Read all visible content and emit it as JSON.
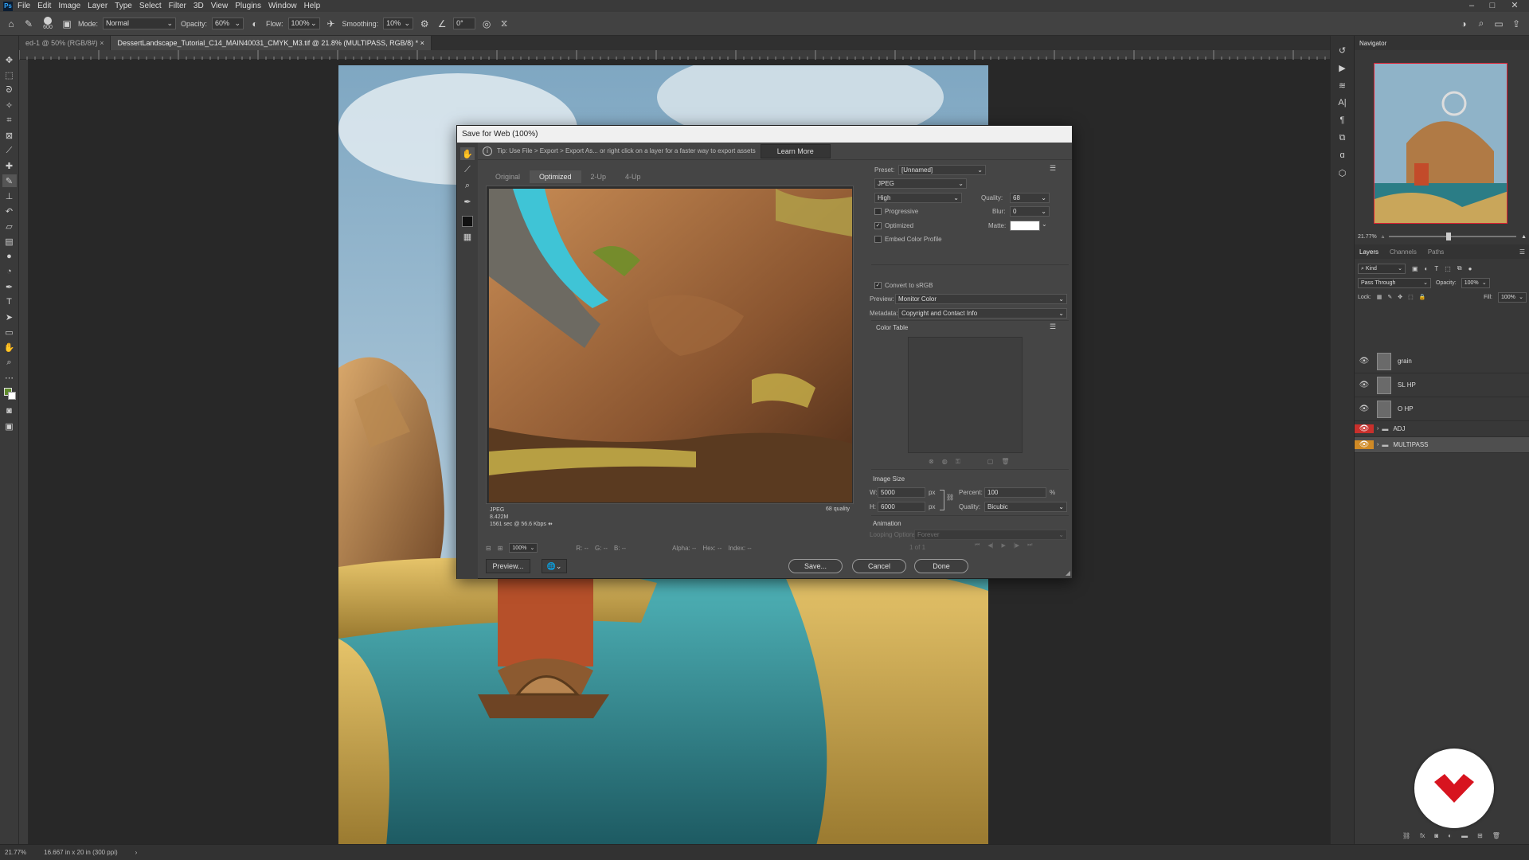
{
  "app": {
    "menu": [
      "File",
      "Edit",
      "Image",
      "Layer",
      "Type",
      "Select",
      "Filter",
      "3D",
      "View",
      "Plugins",
      "Window",
      "Help"
    ],
    "window_controls": [
      "–",
      "□",
      "✕"
    ]
  },
  "options_bar": {
    "brush_size": "600",
    "mode_label": "Mode:",
    "mode_value": "Normal",
    "opacity_label": "Opacity:",
    "opacity_value": "60%",
    "flow_label": "Flow:",
    "flow_value": "100%",
    "smoothing_label": "Smoothing:",
    "smoothing_value": "10%",
    "angle_value": "0°"
  },
  "tabs": [
    {
      "label": "ed-1 @ 50% (RGB/8#)",
      "active": false
    },
    {
      "label": "DessertLandscape_Tutorial_C14_MAIN40031_CMYK_M3.tif @ 21.8% (MULTIPASS, RGB/8) *",
      "active": true
    }
  ],
  "dialog": {
    "title": "Save for Web (100%)",
    "tip": "Tip: Use File > Export > Export As...  or right click on a layer for a faster way to export assets",
    "learn_more": "Learn More",
    "view_tabs": [
      "Original",
      "Optimized",
      "2-Up",
      "4-Up"
    ],
    "active_view": "Optimized",
    "preview_info": {
      "format": "JPEG",
      "size": "8.422M",
      "time": "1561 sec @ 56.6 Kbps",
      "quality_note": "68 quality"
    },
    "status": {
      "zoom": "100%",
      "r": "R: --",
      "g": "G: --",
      "b": "B: --",
      "alpha": "Alpha: --",
      "hex": "Hex: --",
      "index": "Index: --"
    },
    "buttons": {
      "preview": "Preview...",
      "save": "Save...",
      "cancel": "Cancel",
      "done": "Done"
    },
    "settings": {
      "preset_label": "Preset:",
      "preset_value": "[Unnamed]",
      "format_value": "JPEG",
      "compression_value": "High",
      "quality_label": "Quality:",
      "quality_value": "68",
      "progressive_label": "Progressive",
      "progressive_checked": false,
      "blur_label": "Blur:",
      "blur_value": "0",
      "optimized_label": "Optimized",
      "optimized_checked": true,
      "matte_label": "Matte:",
      "embed_label": "Embed Color Profile",
      "embed_checked": false,
      "convert_label": "Convert to sRGB",
      "convert_checked": true,
      "preview_label": "Preview:",
      "preview_value": "Monitor Color",
      "metadata_label": "Metadata:",
      "metadata_value": "Copyright and Contact Info",
      "color_table_label": "Color Table",
      "image_size_label": "Image Size",
      "w_label": "W:",
      "w_value": "5000",
      "h_label": "H:",
      "h_value": "6000",
      "px": "px",
      "percent_label": "Percent:",
      "percent_value": "100",
      "percent_unit": "%",
      "quality2_label": "Quality:",
      "quality2_value": "Bicubic",
      "animation_label": "Animation",
      "looping_label": "Looping Options:",
      "looping_value": "Forever",
      "frame_counter": "1 of 1"
    }
  },
  "navigator": {
    "title": "Navigator",
    "zoom": "21.77%"
  },
  "layers_panel": {
    "tabs": [
      "Layers",
      "Channels",
      "Paths"
    ],
    "kind_label": "Kind",
    "blend_mode": "Pass Through",
    "opacity_label": "Opacity:",
    "opacity_value": "100%",
    "lock_label": "Lock:",
    "fill_label": "Fill:",
    "fill_value": "100%",
    "layers": [
      {
        "name": "grain",
        "type": "layer"
      },
      {
        "name": "SL HP",
        "type": "layer"
      },
      {
        "name": "O HP",
        "type": "layer"
      },
      {
        "name": "ADJ",
        "type": "group",
        "eye_color": "#d9534f"
      },
      {
        "name": "MULTIPASS",
        "type": "group",
        "eye_color": "#e39a2e",
        "selected": true
      }
    ]
  },
  "statusbar": {
    "zoom": "21.77%",
    "doc_info": "16.667 in x 20 in (300 ppi)"
  },
  "colors": {
    "accent_red": "#d7141f",
    "ps_blue": "#31a8ff"
  }
}
